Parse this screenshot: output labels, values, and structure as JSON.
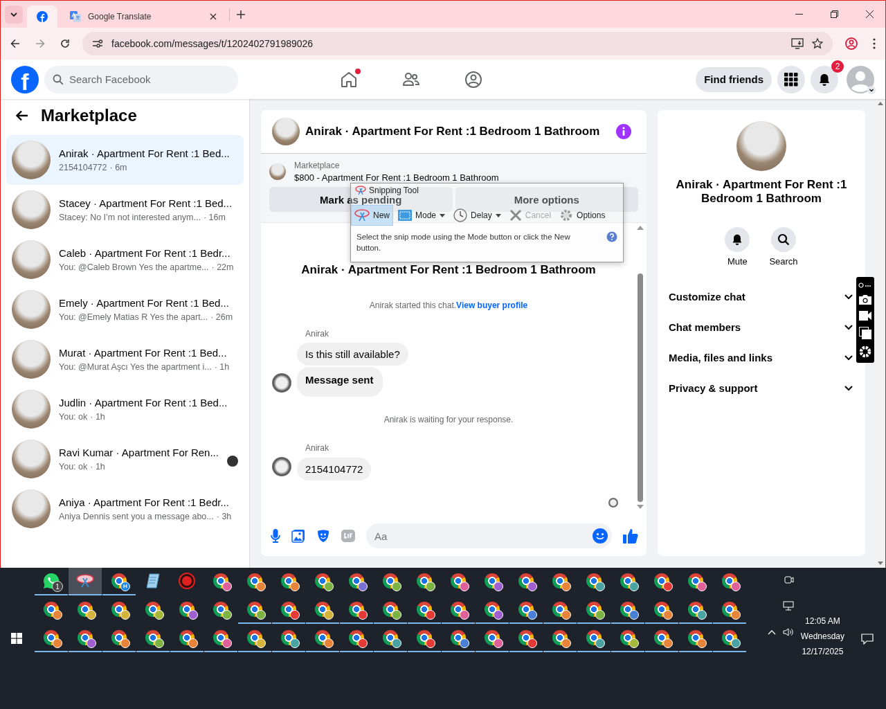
{
  "browser": {
    "tabs": [
      {
        "kind": "facebook",
        "selected": true
      },
      {
        "kind": "translate",
        "title": "Google Translate",
        "selected": false
      }
    ],
    "url": "facebook.com/messages/t/1202402791989026"
  },
  "facebook_nav": {
    "logo": "f",
    "search_placeholder": "Search Facebook",
    "nav_items": [
      {
        "kind": "home",
        "dot": true
      },
      {
        "kind": "friends",
        "dot": false
      },
      {
        "kind": "groups",
        "dot": false
      }
    ],
    "find_friends": "Find friends",
    "notification_count": "2"
  },
  "sidebar": {
    "title": "Marketplace",
    "conversations": [
      {
        "title": "Anirak · Apartment For Rent :1 Bed...",
        "preview": "2154104772",
        "time": "· 6m",
        "selected": true,
        "seen": false
      },
      {
        "title": "Stacey · Apartment For Rent :1 Bed...",
        "preview": "Stacey: No I’m not interested anym...",
        "time": "· 16m",
        "selected": false,
        "seen": false
      },
      {
        "title": "Caleb · Apartment For Rent :1 Bedr...",
        "preview": "You: @Caleb Brown Yes the apartme...",
        "time": "· 22m",
        "selected": false,
        "seen": false
      },
      {
        "title": "Emely · Apartment For Rent :1 Bed...",
        "preview": "You: @Emely Matias R Yes the apart...",
        "time": "· 26m",
        "selected": false,
        "seen": false
      },
      {
        "title": "Murat · Apartment For Rent :1 Bed...",
        "preview": "You: @Murat Aşcı Yes the apartment i...",
        "time": "· 1h",
        "selected": false,
        "seen": false
      },
      {
        "title": "Judlin · Apartment For Rent :1 Bed...",
        "preview": "You: ok",
        "time": "· 1h",
        "selected": false,
        "seen": false
      },
      {
        "title": "Ravi Kumar · Apartment For Ren...",
        "preview": "You: ok",
        "time": "· 1h",
        "selected": false,
        "seen": true
      },
      {
        "title": "Aniya · Apartment For Rent :1 Bedr...",
        "preview": "Aniya Dennis sent you a message abo...",
        "time": "· 3h",
        "selected": false,
        "seen": false
      }
    ]
  },
  "chat": {
    "title": "Anirak · Apartment For Rent :1 Bedroom 1 Bathroom",
    "listing": {
      "label": "Marketplace",
      "price_line": "$800 - Apartment For Rent :1 Bedroom 1 Bathroom",
      "buttons": [
        "Mark as pending",
        "More options"
      ]
    },
    "messages": [
      {
        "kind": "heading",
        "text": "Anirak · Apartment For Rent :1 Bedroom 1 Bathroom"
      },
      {
        "kind": "notice",
        "text": "Anirak started this chat.",
        "link": "View buyer profile"
      },
      {
        "kind": "group",
        "sender": "Anirak",
        "bubbles": [
          {
            "text": "Is this still available?",
            "bold": false
          },
          {
            "text": "Message sent",
            "bold": true
          }
        ]
      },
      {
        "kind": "notice",
        "text": "Anirak is waiting for your response."
      },
      {
        "kind": "group",
        "sender": "Anirak",
        "bubbles": [
          {
            "text": "2154104772",
            "bold": false
          }
        ]
      }
    ],
    "seen": true,
    "composer_placeholder": "Aa"
  },
  "snipping_tool": {
    "title": "Snipping Tool",
    "tools": [
      {
        "kind": "new",
        "label": "New",
        "selected": true,
        "disabled": false
      },
      {
        "kind": "mode",
        "label": "Mode",
        "selected": false,
        "disabled": false
      },
      {
        "kind": "delay",
        "label": "Delay",
        "selected": false,
        "disabled": false
      },
      {
        "kind": "cancel",
        "label": "Cancel",
        "selected": false,
        "disabled": true
      },
      {
        "kind": "options",
        "label": "Options",
        "selected": false,
        "disabled": false
      }
    ],
    "hint": "Select the snip mode using the Mode button or click the New button."
  },
  "details": {
    "title": "Anirak · Apartment For Rent :1 Bedroom 1 Bathroom",
    "actions": [
      {
        "kind": "mute",
        "label": "Mute"
      },
      {
        "kind": "search",
        "label": "Search"
      }
    ],
    "sections": [
      {
        "label": "Customize chat",
        "expanded": false
      },
      {
        "label": "Chat members",
        "expanded": false
      },
      {
        "label": "Media, files and links",
        "expanded": false
      },
      {
        "label": "Privacy & support",
        "expanded": false
      }
    ]
  },
  "taskbar": {
    "rows": [
      [
        {
          "kind": "whatsapp",
          "badge": "1",
          "running": true,
          "selected": false
        },
        {
          "kind": "snip",
          "running": true,
          "selected": true
        },
        {
          "kind": "chrome",
          "color": "#1e88e5",
          "badge": "H",
          "running": true,
          "selected": false
        },
        {
          "kind": "notes",
          "running": false,
          "selected": false
        },
        {
          "kind": "record",
          "running": false,
          "selected": false
        },
        {
          "kind": "chrome",
          "color": "#e0609a",
          "running": false,
          "selected": false
        },
        {
          "kind": "chrome",
          "color": "#e8833a",
          "running": false,
          "selected": false
        },
        {
          "kind": "chrome",
          "color": "#e8833a",
          "running": false,
          "selected": false
        },
        {
          "kind": "chrome",
          "color": "#7cb342",
          "running": false,
          "selected": false
        },
        {
          "kind": "chrome",
          "color": "#7b6fd6",
          "running": false,
          "selected": false
        },
        {
          "kind": "chrome",
          "color": "#7cb342",
          "running": false,
          "selected": false
        },
        {
          "kind": "chrome",
          "color": "#7cb342",
          "running": false,
          "selected": false
        },
        {
          "kind": "chrome",
          "color": "#e0609a",
          "running": false,
          "selected": false
        },
        {
          "kind": "chrome",
          "color": "#a05fd0",
          "running": false,
          "selected": false
        },
        {
          "kind": "chrome",
          "color": "#a05fd0",
          "running": false,
          "selected": false
        },
        {
          "kind": "chrome",
          "color": "#e8833a",
          "running": false,
          "selected": false
        },
        {
          "kind": "chrome",
          "color": "#4aa3a3",
          "running": false,
          "selected": false
        },
        {
          "kind": "chrome",
          "color": "#4aa3a3",
          "running": false,
          "selected": false
        },
        {
          "kind": "chrome",
          "color": "#e53935",
          "running": false,
          "selected": false
        },
        {
          "kind": "chrome",
          "color": "#e0609a",
          "running": false,
          "selected": false
        },
        {
          "kind": "chrome",
          "color": "#e0609a",
          "running": false,
          "selected": false
        }
      ],
      [
        {
          "kind": "chrome",
          "color": "#e8833a",
          "running": false,
          "selected": false
        },
        {
          "kind": "chrome",
          "color": "#d4b43a",
          "running": false,
          "selected": false
        },
        {
          "kind": "chrome",
          "color": "#d4b43a",
          "running": false,
          "selected": false
        },
        {
          "kind": "chrome",
          "color": "#a5b83a",
          "running": false,
          "selected": false
        },
        {
          "kind": "chrome",
          "color": "#a05fd0",
          "running": false,
          "selected": false
        },
        {
          "kind": "chrome",
          "color": "#7cb342",
          "running": false,
          "selected": false
        },
        {
          "kind": "chrome",
          "color": "#7cb342",
          "running": true,
          "selected": false
        },
        {
          "kind": "chrome",
          "color": "#e53935",
          "running": true,
          "selected": false
        },
        {
          "kind": "chrome",
          "color": "#d4b43a",
          "running": true,
          "selected": false
        },
        {
          "kind": "chrome",
          "color": "#e53935",
          "running": true,
          "selected": false
        },
        {
          "kind": "chrome",
          "color": "#7cb342",
          "running": true,
          "selected": false
        },
        {
          "kind": "chrome",
          "color": "#e53935",
          "running": true,
          "selected": false
        },
        {
          "kind": "chrome",
          "color": "#e0609a",
          "running": true,
          "selected": false
        },
        {
          "kind": "chrome",
          "color": "#a05fd0",
          "running": true,
          "selected": false
        },
        {
          "kind": "chrome",
          "color": "#4a7fd6",
          "running": true,
          "selected": false
        },
        {
          "kind": "chrome",
          "color": "#e8833a",
          "running": true,
          "selected": false
        },
        {
          "kind": "chrome",
          "color": "#7cb342",
          "running": true,
          "selected": false
        },
        {
          "kind": "chrome",
          "color": "#4a7fd6",
          "running": true,
          "selected": false
        },
        {
          "kind": "chrome",
          "color": "#e8833a",
          "running": true,
          "selected": false
        },
        {
          "kind": "chrome",
          "color": "#4aa3a3",
          "running": true,
          "selected": false
        },
        {
          "kind": "chrome",
          "color": "#e8833a",
          "running": true,
          "selected": false
        }
      ],
      [
        {
          "kind": "chrome",
          "color": "#e8833a",
          "running": true,
          "selected": false
        },
        {
          "kind": "chrome",
          "color": "#a05fd0",
          "running": true,
          "selected": false
        },
        {
          "kind": "chrome",
          "color": "#e8833a",
          "running": true,
          "selected": false
        },
        {
          "kind": "chrome",
          "color": "#7cb342",
          "running": true,
          "selected": false
        },
        {
          "kind": "chrome",
          "color": "#e8833a",
          "running": true,
          "selected": false
        },
        {
          "kind": "chrome",
          "color": "#e0609a",
          "running": true,
          "selected": false
        },
        {
          "kind": "chrome",
          "color": "#d4b43a",
          "running": true,
          "selected": false
        },
        {
          "kind": "chrome",
          "color": "#4aa3a3",
          "running": true,
          "selected": false
        },
        {
          "kind": "chrome",
          "color": "#e8833a",
          "running": true,
          "selected": false
        },
        {
          "kind": "chrome",
          "color": "#e53935",
          "running": true,
          "selected": false
        },
        {
          "kind": "chrome",
          "color": "#4aa3a3",
          "running": true,
          "selected": false
        },
        {
          "kind": "chrome",
          "color": "#e53935",
          "running": true,
          "selected": false
        },
        {
          "kind": "chrome",
          "color": "#4a7fd6",
          "running": true,
          "selected": false
        },
        {
          "kind": "chrome",
          "color": "#e0609a",
          "running": true,
          "selected": false
        },
        {
          "kind": "chrome",
          "color": "#e53935",
          "running": true,
          "selected": false
        },
        {
          "kind": "chrome",
          "color": "#e8833a",
          "running": true,
          "selected": false
        },
        {
          "kind": "chrome",
          "color": "#4aa3a3",
          "running": true,
          "selected": false
        },
        {
          "kind": "chrome",
          "color": "#a5b83a",
          "running": true,
          "selected": false
        },
        {
          "kind": "chrome",
          "color": "#e8833a",
          "running": true,
          "selected": false
        },
        {
          "kind": "chrome",
          "color": "#e8833a",
          "running": true,
          "selected": false
        },
        {
          "kind": "chrome",
          "color": "#4aa3a3",
          "running": true,
          "selected": false
        }
      ]
    ],
    "clock": {
      "time": "12:05 AM",
      "day": "Wednesday",
      "date": "12/17/2025"
    }
  }
}
